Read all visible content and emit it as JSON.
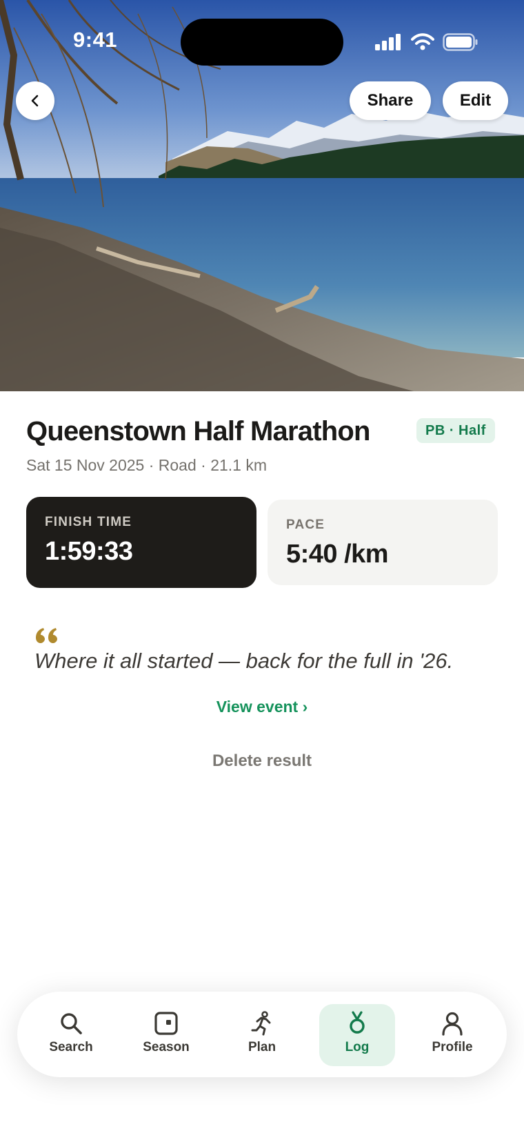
{
  "status_bar": {
    "time": "9:41"
  },
  "header": {
    "back_icon": "chevron-left-icon",
    "share_label": "Share",
    "edit_label": "Edit"
  },
  "result": {
    "title": "Queenstown Half Marathon",
    "badge": "PB · Half",
    "subtitle": "Sat 15 Nov 2025 · Road · 21.1 km",
    "finish": {
      "label": "FINISH TIME",
      "value": "1:59:33"
    },
    "pace": {
      "label": "PACE",
      "value": "5:40 /km"
    },
    "note": "Where it all started — back for the full in '26.",
    "view_event_label": "View event ›",
    "delete_label": "Delete result"
  },
  "tabbar": {
    "active": "Log",
    "items": [
      {
        "label": "Search",
        "icon": "search-icon"
      },
      {
        "label": "Season",
        "icon": "season-icon"
      },
      {
        "label": "Plan",
        "icon": "runner-icon"
      },
      {
        "label": "Log",
        "icon": "medal-icon"
      },
      {
        "label": "Profile",
        "icon": "profile-icon"
      }
    ]
  },
  "colors": {
    "accent_green": "#15925b",
    "badge_bg": "#e3f3ea",
    "dark_card": "#1e1c19",
    "quote_gold": "#b08a2e"
  }
}
